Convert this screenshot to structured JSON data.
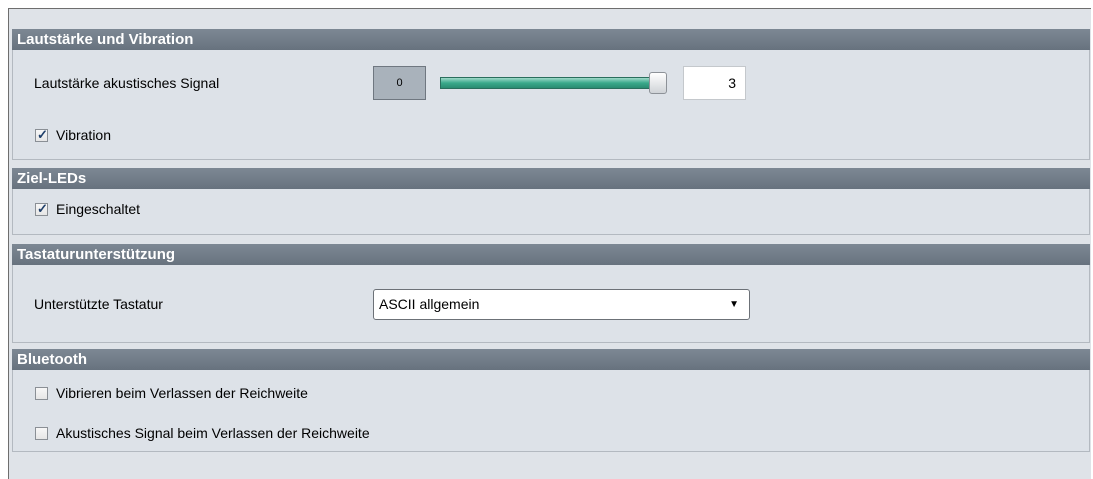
{
  "sections": {
    "volume": {
      "title": "Lautstärke und Vibration",
      "signal_label": "Lautstärke akustisches Signal",
      "slider_min": "0",
      "slider_value": "3",
      "slider_fraction": 1.0,
      "vibration_label": "Vibration",
      "vibration_checked": true
    },
    "leds": {
      "title": "Ziel-LEDs",
      "enabled_label": "Eingeschaltet",
      "enabled_checked": true
    },
    "keyboard": {
      "title": "Tastaturunterstützung",
      "keyboard_label": "Unterstützte Tastatur",
      "selected": "ASCII allgemein"
    },
    "bluetooth": {
      "title": "Bluetooth",
      "vibrate_label": "Vibrieren beim Verlassen der Reichweite",
      "vibrate_checked": false,
      "signal_label": "Akustisches Signal beim Verlassen der Reichweite",
      "signal_checked": false
    }
  },
  "icons": {
    "check": "checkmark-icon",
    "dropdown": "chevron-down-icon"
  },
  "colors": {
    "header": "#6f7a86",
    "body": "#dde2e8",
    "slider": "#3aa98b"
  }
}
